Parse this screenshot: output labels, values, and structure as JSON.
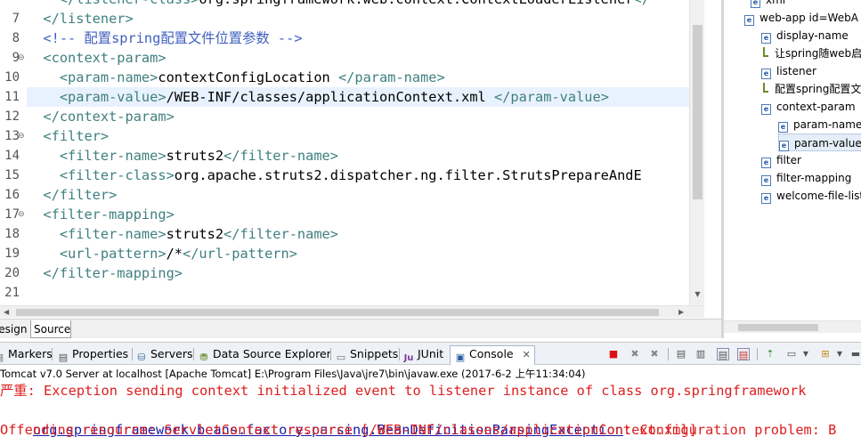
{
  "editor": {
    "lines": [
      {
        "n": "",
        "fold": "",
        "parts": [
          {
            "c": "tag",
            "t": "  </listener-class>"
          },
          {
            "c": "txt",
            "t": "org.springframework.web.context.ContextLoaderListener"
          },
          {
            "c": "tag",
            "t": "</"
          }
        ]
      },
      {
        "n": "7",
        "fold": "",
        "parts": [
          {
            "c": "tag",
            "t": "</listener>"
          }
        ]
      },
      {
        "n": "8",
        "fold": "",
        "parts": [
          {
            "c": "cmt",
            "t": "<!-- 配置spring配置文件位置参数 -->"
          }
        ]
      },
      {
        "n": "9",
        "fold": "⊖",
        "parts": [
          {
            "c": "tag",
            "t": "<context-param>"
          }
        ]
      },
      {
        "n": "10",
        "fold": "",
        "parts": [
          {
            "c": "tag",
            "t": "  <param-name>"
          },
          {
            "c": "txt",
            "t": "contextConfigLocation "
          },
          {
            "c": "tag",
            "t": "</param-name>"
          }
        ]
      },
      {
        "n": "11",
        "fold": "",
        "hl": true,
        "parts": [
          {
            "c": "tag",
            "t": "  <param-value>"
          },
          {
            "c": "txt",
            "t": "/WEB-INF/classes/applicationContext.xml "
          },
          {
            "c": "tag",
            "t": "</param-value>"
          }
        ]
      },
      {
        "n": "12",
        "fold": "",
        "parts": [
          {
            "c": "tag",
            "t": "</context-param>"
          }
        ]
      },
      {
        "n": "13",
        "fold": "⊖",
        "parts": [
          {
            "c": "tag",
            "t": "<filter>"
          }
        ]
      },
      {
        "n": "14",
        "fold": "",
        "parts": [
          {
            "c": "tag",
            "t": "  <filter-name>"
          },
          {
            "c": "txt",
            "t": "struts2"
          },
          {
            "c": "tag",
            "t": "</filter-name>"
          }
        ]
      },
      {
        "n": "15",
        "fold": "",
        "parts": [
          {
            "c": "tag",
            "t": "  <filter-class>"
          },
          {
            "c": "txt",
            "t": "org.apache.struts2.dispatcher.ng.filter.StrutsPrepareAndE"
          }
        ]
      },
      {
        "n": "16",
        "fold": "",
        "parts": [
          {
            "c": "tag",
            "t": "</filter>"
          }
        ]
      },
      {
        "n": "17",
        "fold": "⊖",
        "parts": [
          {
            "c": "tag",
            "t": "<filter-mapping>"
          }
        ]
      },
      {
        "n": "18",
        "fold": "",
        "parts": [
          {
            "c": "tag",
            "t": "  <filter-name>"
          },
          {
            "c": "txt",
            "t": "struts2"
          },
          {
            "c": "tag",
            "t": "</filter-name>"
          }
        ]
      },
      {
        "n": "19",
        "fold": "",
        "parts": [
          {
            "c": "tag",
            "t": "  <url-pattern>"
          },
          {
            "c": "txt",
            "t": "/*"
          },
          {
            "c": "tag",
            "t": "</url-pattern>"
          }
        ]
      },
      {
        "n": "20",
        "fold": "",
        "parts": [
          {
            "c": "tag",
            "t": "</filter-mapping>"
          }
        ]
      },
      {
        "n": "21",
        "fold": "",
        "parts": []
      }
    ],
    "tabs": {
      "design": "Design",
      "source": "Source"
    }
  },
  "outline": {
    "rows": [
      {
        "icon": "element-icon",
        "label": "xml",
        "indent": 30
      },
      {
        "icon": "element-icon",
        "label": "web-app id=WebA",
        "indent": 23
      },
      {
        "icon": "element-icon",
        "label": "display-name",
        "indent": 42
      },
      {
        "icon": "comment-icon",
        "label": "让spring随web启",
        "indent": 42
      },
      {
        "icon": "element-icon",
        "label": "listener",
        "indent": 42
      },
      {
        "icon": "comment-icon",
        "label": "配置spring配置文",
        "indent": 42
      },
      {
        "icon": "element-icon",
        "label": "context-param",
        "indent": 42
      },
      {
        "icon": "element-icon",
        "label": "param-name",
        "indent": 61
      },
      {
        "icon": "element-icon",
        "label": "param-value",
        "indent": 61,
        "selected": true
      },
      {
        "icon": "element-icon",
        "label": "filter",
        "indent": 42
      },
      {
        "icon": "element-icon",
        "label": "filter-mapping",
        "indent": 42
      },
      {
        "icon": "element-icon",
        "label": "welcome-file-list",
        "indent": 42
      }
    ]
  },
  "console": {
    "tabs": {
      "markers": "Markers",
      "properties": "Properties",
      "servers": "Servers",
      "datasource": "Data Source Explorer",
      "snippets": "Snippets",
      "junit": "JUnit",
      "console": "Console"
    },
    "status": "Tomcat v7.0 Server at localhost [Apache Tomcat] E:\\Program Files\\Java\\jre7\\bin\\javaw.exe (2017-6-2 上午11:34:04)",
    "line1": "严重: Exception sending context initialized event to listener instance of class org.springframework",
    "line2_link": "org.springframework.beans.factory.parsing.BeanDefinitionParsingException",
    "line2_rest": ": Configuration problem: B",
    "line3": "Offending resource: ServletContext resource [/WEB-INF/classes/applicationContext.xml]"
  },
  "colors": {
    "tag": "#3f7f7f",
    "comment": "#3f5fbf",
    "error": "#dd1e1e",
    "link": "#1a1aa6",
    "highlight": "#e8f2fe"
  }
}
